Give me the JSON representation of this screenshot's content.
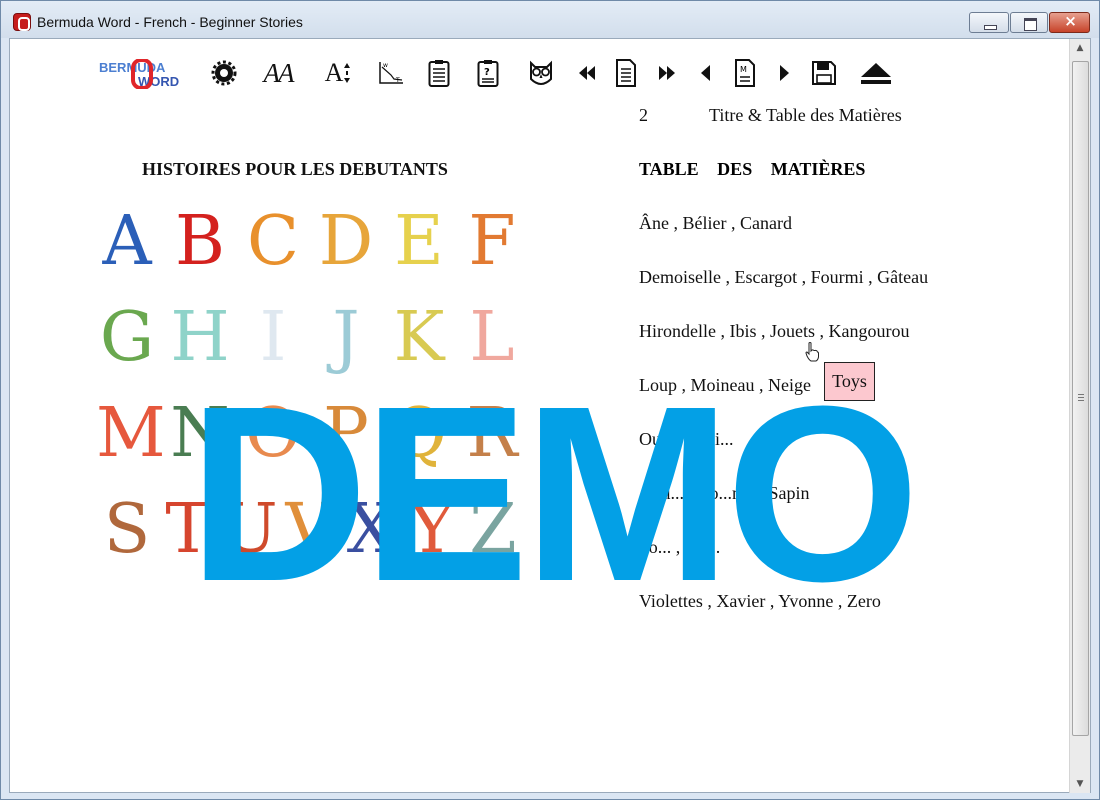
{
  "window": {
    "title": "Bermuda Word - French - Beginner Stories",
    "close_glyph": "×"
  },
  "toolbar": {
    "logo_text_top": "BERMUDA",
    "logo_text_bottom": "WORD",
    "buttons": [
      {
        "name": "settings",
        "icon": "gear-icon"
      },
      {
        "name": "font-style",
        "icon": "font-style-icon",
        "glyph": "AA"
      },
      {
        "name": "font-size",
        "icon": "font-size-icon",
        "glyph": "A"
      },
      {
        "name": "chart",
        "icon": "chart-icon"
      },
      {
        "name": "notes",
        "icon": "clipboard-icon"
      },
      {
        "name": "quiz",
        "icon": "quiz-clipboard-icon"
      },
      {
        "name": "owl",
        "icon": "owl-icon"
      },
      {
        "name": "first-page",
        "icon": "double-left-arrow-icon"
      },
      {
        "name": "page",
        "icon": "page-icon"
      },
      {
        "name": "last-page",
        "icon": "double-right-arrow-icon"
      },
      {
        "name": "prev",
        "icon": "left-arrow-icon"
      },
      {
        "name": "word-page",
        "icon": "page-m-icon"
      },
      {
        "name": "next",
        "icon": "right-arrow-icon"
      },
      {
        "name": "save",
        "icon": "floppy-disk-icon"
      },
      {
        "name": "eject",
        "icon": "eject-icon"
      }
    ]
  },
  "page": {
    "number": "2",
    "title": "Titre & Table des Matières",
    "left_heading": "HISTOIRES POUR LES DEBUTANTS",
    "toc_heading": "TABLE DES MATIÈRES",
    "toc_lines": [
      "Âne ,  Bélier ,  Canard",
      "Demoiselle ,  Escargot ,  Fourmi ,  Gâteau",
      "Hirondelle ,  Ibis ,  Jouets ,  Kangourou",
      "Loup ,  Moineau ,  Neige",
      "Ou...e ,  Poi...",
      "...qu... ,  Ro...nol ,  Sapin",
      "To... ,  Un...",
      "Violettes ,  Xavier ,  Yvonne ,  Zero"
    ]
  },
  "alphabet": {
    "letters": [
      "A",
      "B",
      "C",
      "D",
      "E",
      "F",
      "G",
      "H",
      "I",
      "J",
      "K",
      "L",
      "M",
      "N",
      "O",
      "P",
      "Q",
      "R",
      "S",
      "T",
      "U",
      "V",
      "X",
      "Y",
      "Z"
    ],
    "colors": [
      "#2b5fb8",
      "#d4211e",
      "#e8902c",
      "#e7a53a",
      "#e6d14d",
      "#e27a32",
      "#6aa84f",
      "#8fd3c9",
      "#dfe8f0",
      "#9ccbd6",
      "#d8ca52",
      "#f0a89e",
      "#e6583d",
      "#4a7d52",
      "#e88a4e",
      "#d88a3a",
      "#e0b33a",
      "#c4804a",
      "#b0683c",
      "#d6452e",
      "#cf4a2b",
      "#e08f3a",
      "#3a4fa0",
      "#e05a3b",
      "#7aa4a0"
    ]
  },
  "tooltip": {
    "text": "Toys"
  },
  "watermark": {
    "text": "DEMO"
  },
  "colors": {
    "watermark": "#03a0e6",
    "tooltip_bg": "#fcc8cf"
  }
}
